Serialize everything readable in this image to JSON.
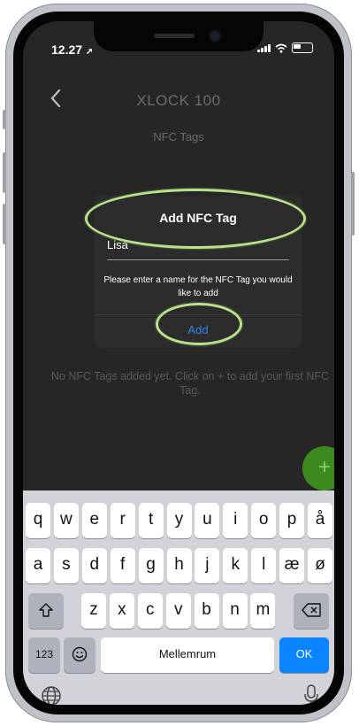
{
  "status_bar": {
    "time": "12.27"
  },
  "header": {
    "back_icon": "chevron-left-icon",
    "title": "XLOCK 100",
    "subtitle": "NFC Tags"
  },
  "dialog": {
    "title": "Add NFC Tag",
    "input_value": "Lisa",
    "message": "Please enter a name for the NFC Tag you would like to add",
    "add_label": "Add"
  },
  "empty_message": "No NFC Tags added yet. Click on + to add your first NFC Tag.",
  "fab": {
    "label": "+"
  },
  "keyboard": {
    "row1": [
      "q",
      "w",
      "e",
      "r",
      "t",
      "y",
      "u",
      "i",
      "o",
      "p",
      "å"
    ],
    "row2": [
      "a",
      "s",
      "d",
      "f",
      "g",
      "h",
      "j",
      "k",
      "l",
      "æ",
      "ø"
    ],
    "row3": [
      "z",
      "x",
      "c",
      "v",
      "b",
      "n",
      "m"
    ],
    "numbers_label": "123",
    "space_label": "Mellemrum",
    "ok_label": "OK",
    "shift_icon": "shift-icon",
    "delete_icon": "backspace-icon",
    "emoji_icon": "emoji-icon",
    "globe_icon": "globe-icon",
    "mic_icon": "microphone-icon"
  },
  "colors": {
    "accent_link": "#2f86e6",
    "fab": "#3f8a1e",
    "annotation": "#b9e08a",
    "ok_key": "#0a84ff"
  }
}
